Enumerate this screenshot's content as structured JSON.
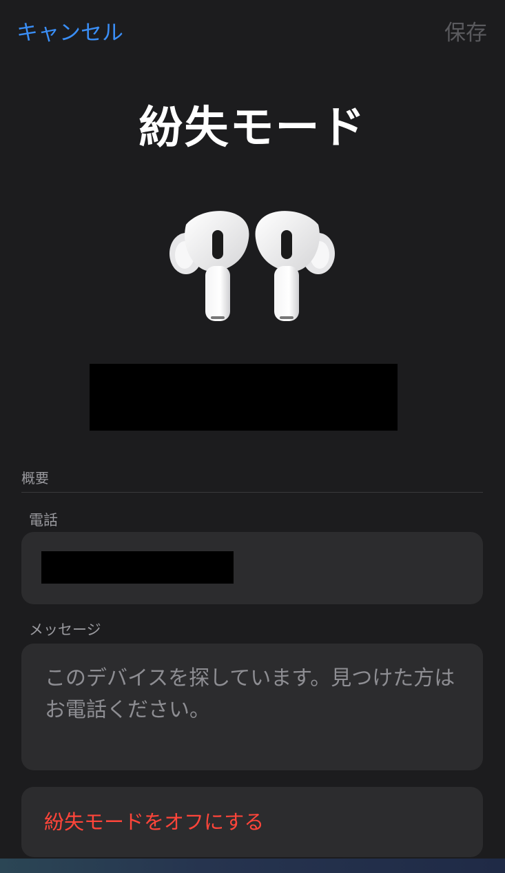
{
  "nav": {
    "cancel_label": "キャンセル",
    "save_label": "保存"
  },
  "header": {
    "title": "紛失モード",
    "device_image": "airpods-pro-icon"
  },
  "section": {
    "header": "概要"
  },
  "phone": {
    "label": "電話"
  },
  "message": {
    "label": "メッセージ",
    "value": "このデバイスを探しています。見つけた方はお電話ください。"
  },
  "action": {
    "label": "紛失モードをオフにする"
  },
  "colors": {
    "accent": "#3a8ef6",
    "destructive": "#ff453a",
    "background": "#1c1c1e",
    "card": "#2c2c2e"
  }
}
